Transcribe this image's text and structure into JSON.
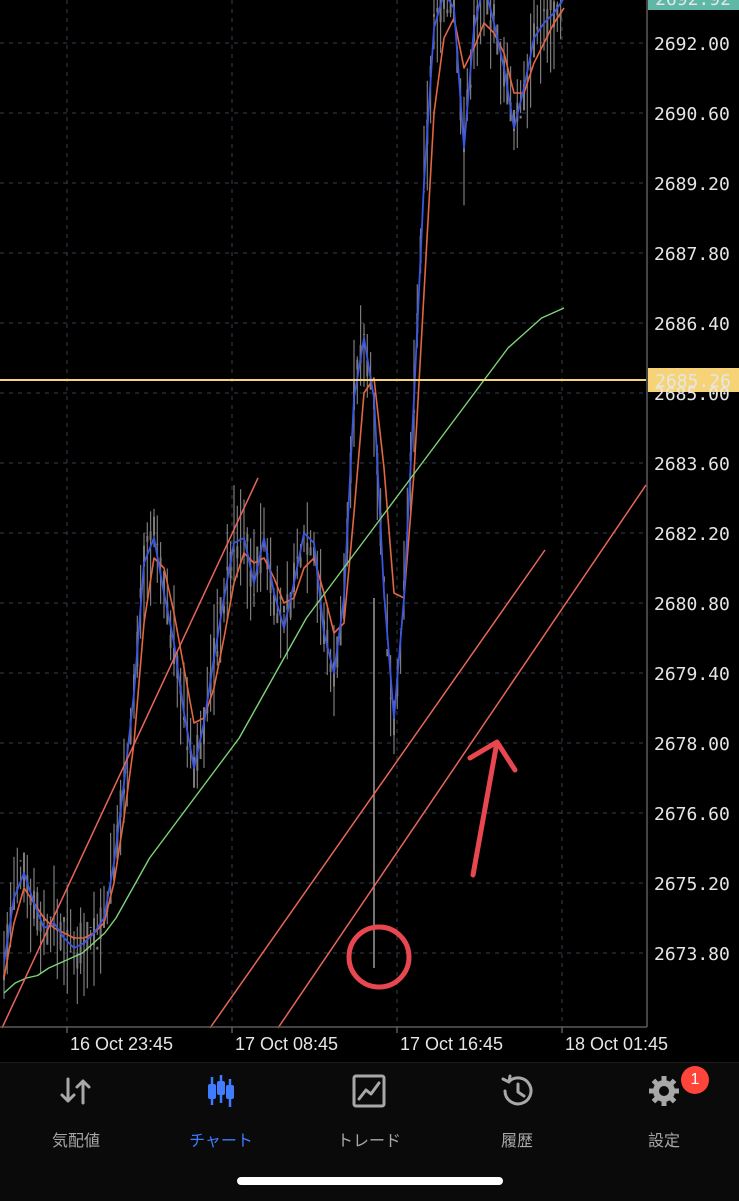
{
  "chart_data": {
    "type": "candlestick",
    "y_ticks": [
      "2692.00",
      "2690.60",
      "2689.20",
      "2687.80",
      "2686.40",
      "2685.00",
      "2683.60",
      "2682.20",
      "2680.80",
      "2679.40",
      "2678.00",
      "2676.60",
      "2675.20",
      "2673.80"
    ],
    "y_tick_values": [
      2692.0,
      2690.6,
      2689.2,
      2687.8,
      2686.4,
      2685.0,
      2683.6,
      2682.2,
      2680.8,
      2679.4,
      2678.0,
      2676.6,
      2675.2,
      2673.8
    ],
    "top_price_label": "2692.92",
    "x_ticks": [
      "16 Oct 23:45",
      "17 Oct 08:45",
      "17 Oct 16:45",
      "18 Oct 01:45"
    ],
    "current_price": 2685.26,
    "current_price_label": "2685.26",
    "grid": true,
    "colors": {
      "background": "#000000",
      "grid": "#33414d",
      "price_line": "#f5d376",
      "price_tag": "#f5d376",
      "candles": "#7b7b7b",
      "ma_blue": "#3a55e0",
      "ma_orange": "#e2663f",
      "ma_green": "#7fd37a",
      "trendline": "#e8665a",
      "annotation": "#e8474f"
    },
    "series": [
      {
        "values": [
          2673.6,
          2674.9,
          2675.4,
          2674.8,
          2674.3,
          2674.4,
          2674.1,
          2673.9,
          2674.0,
          2674.2,
          2674.5,
          2675.6,
          2677.2,
          2679.0,
          2681.6,
          2682.1,
          2681.0,
          2680.0,
          2678.6,
          2677.5,
          2678.4,
          2679.7,
          2680.9,
          2682.0,
          2682.1,
          2681.2,
          2682.1,
          2681.0,
          2680.3,
          2681.2,
          2682.2,
          2682.0,
          2680.2,
          2679.4,
          2680.9,
          2684.9,
          2686.1,
          2684.9,
          2681.0,
          2678.5,
          2680.9,
          2684.9,
          2689.2,
          2692.3,
          2693.0,
          2692.7,
          2689.9,
          2692.3,
          2693.2,
          2692.4,
          2691.5,
          2690.3,
          2691.1,
          2692.1,
          2692.4,
          2692.6,
          2692.9
        ]
      },
      {
        "values": [
          2673.3,
          2674.4,
          2675.1,
          2674.8,
          2674.5,
          2674.3,
          2674.2,
          2674.1,
          2674.1,
          2674.2,
          2674.4,
          2675.2,
          2676.5,
          2678.0,
          2680.4,
          2681.7,
          2681.5,
          2680.6,
          2679.5,
          2678.4,
          2678.5,
          2679.1,
          2680.1,
          2681.2,
          2681.8,
          2681.6,
          2681.7,
          2681.3,
          2680.8,
          2680.9,
          2681.5,
          2681.7,
          2681.0,
          2680.2,
          2680.4,
          2682.6,
          2685.0,
          2685.3,
          2683.5,
          2681.0,
          2680.9,
          2683.4,
          2687.0,
          2690.6,
          2692.1,
          2692.5,
          2691.5,
          2691.9,
          2692.4,
          2692.2,
          2691.8,
          2691.0,
          2691.0,
          2691.6,
          2692.0,
          2692.4,
          2692.7
        ]
      },
      {
        "values": [
          2673.0,
          2673.2,
          2673.3,
          2673.35,
          2673.5,
          2673.6,
          2673.7,
          2673.8,
          2674.0,
          2674.2,
          2674.5,
          2674.9,
          2675.3,
          2675.7,
          2676.0,
          2676.3,
          2676.6,
          2676.9,
          2677.2,
          2677.5,
          2677.8,
          2678.1,
          2678.5,
          2678.9,
          2679.3,
          2679.7,
          2680.1,
          2680.5,
          2680.8,
          2681.1,
          2681.4,
          2681.7,
          2682.0,
          2682.3,
          2682.6,
          2682.9,
          2683.2,
          2683.5,
          2683.8,
          2684.1,
          2684.4,
          2684.7,
          2685.0,
          2685.3,
          2685.6,
          2685.9,
          2686.1,
          2686.3,
          2686.5,
          2686.6,
          2686.7
        ]
      }
    ]
  },
  "tabs": [
    {
      "label": "気配値",
      "icon": "quotes-arrows-icon"
    },
    {
      "label": "チャート",
      "icon": "chart-candles-icon"
    },
    {
      "label": "トレード",
      "icon": "trade-chart-icon"
    },
    {
      "label": "履歴",
      "icon": "history-clock-icon"
    },
    {
      "label": "設定",
      "icon": "settings-gear-icon",
      "badge": "1"
    }
  ],
  "active_tab": 1
}
